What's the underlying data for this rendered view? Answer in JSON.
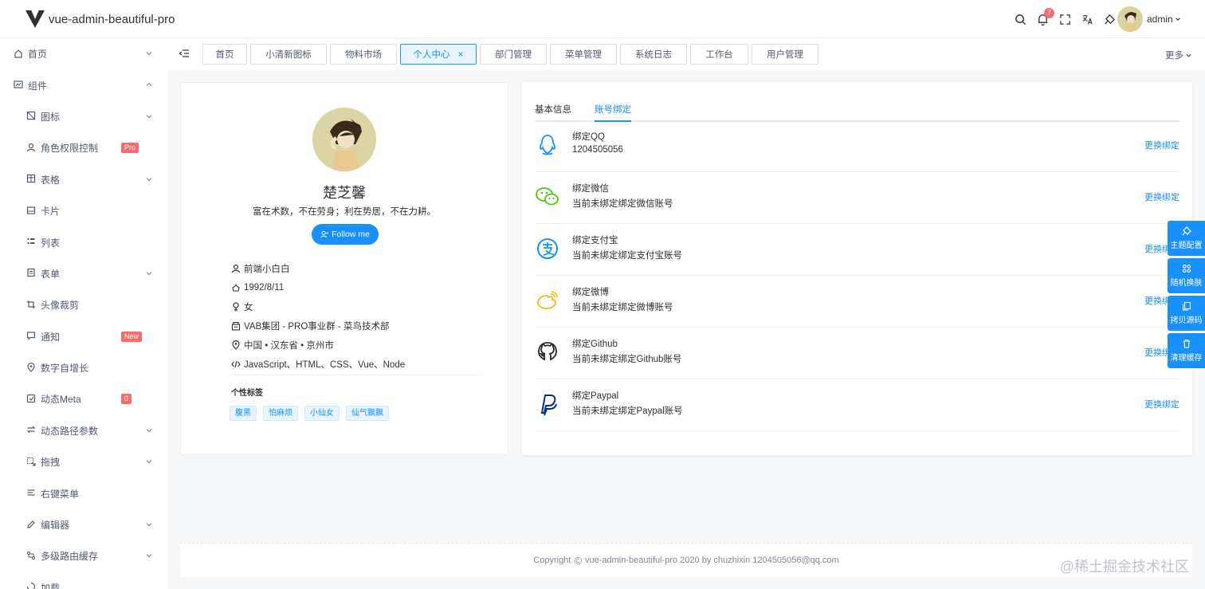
{
  "app": {
    "title": "vue-admin-beautiful-pro"
  },
  "header": {
    "notification_count": "7",
    "user_name": "admin"
  },
  "sidebar": {
    "items": [
      {
        "label": "首页",
        "icon": "home-icon",
        "level": 1,
        "arrow": "down"
      },
      {
        "label": "组件",
        "icon": "component-icon",
        "level": 1,
        "arrow": "up"
      },
      {
        "label": "图标",
        "icon": "icon-icon",
        "level": 2,
        "arrow": "down"
      },
      {
        "label": "角色权限控制",
        "icon": "user-icon",
        "level": 2,
        "badge": "Pro"
      },
      {
        "label": "表格",
        "icon": "table-icon",
        "level": 2,
        "arrow": "down"
      },
      {
        "label": "卡片",
        "icon": "card-icon",
        "level": 2
      },
      {
        "label": "列表",
        "icon": "list-icon",
        "level": 2
      },
      {
        "label": "表单",
        "icon": "form-icon",
        "level": 2,
        "arrow": "down"
      },
      {
        "label": "头像裁剪",
        "icon": "crop-icon",
        "level": 2
      },
      {
        "label": "通知",
        "icon": "message-icon",
        "level": 2,
        "badge": "New"
      },
      {
        "label": "数字自增长",
        "icon": "location-icon",
        "level": 2
      },
      {
        "label": "动态Meta",
        "icon": "meta-icon",
        "level": 2,
        "badge": "0"
      },
      {
        "label": "动态路径参数",
        "icon": "swap-icon",
        "level": 2,
        "arrow": "down"
      },
      {
        "label": "拖拽",
        "icon": "drag-icon",
        "level": 2,
        "arrow": "down"
      },
      {
        "label": "右键菜单",
        "icon": "menu-icon",
        "level": 2
      },
      {
        "label": "编辑器",
        "icon": "edit-icon",
        "level": 2,
        "arrow": "down"
      },
      {
        "label": "多级路由缓存",
        "icon": "route-icon",
        "level": 2,
        "arrow": "down"
      },
      {
        "label": "加载",
        "icon": "loading-icon",
        "level": 2
      }
    ]
  },
  "tabs": {
    "items": [
      {
        "label": "首页",
        "width": 56
      },
      {
        "label": "小清新图标",
        "width": 96
      },
      {
        "label": "物料市场",
        "width": 84
      },
      {
        "label": "个人中心",
        "width": 96,
        "active": true
      },
      {
        "label": "部门管理",
        "width": 84
      },
      {
        "label": "菜单管理",
        "width": 84
      },
      {
        "label": "系统日志",
        "width": 84
      },
      {
        "label": "工作台",
        "width": 73
      },
      {
        "label": "用户管理",
        "width": 84
      }
    ],
    "more": "更多"
  },
  "profile": {
    "name": "楚芝馨",
    "motto": "富在术数，不在劳身；利在势居，不在力耕。",
    "follow": "Follow me",
    "info": [
      {
        "icon": "user-icon",
        "text": "前端小白白"
      },
      {
        "icon": "birthday-icon",
        "text": "1992/8/11"
      },
      {
        "icon": "female-icon",
        "text": "女"
      },
      {
        "icon": "building-icon",
        "text": "VAB集团 - PRO事业群 - 菜鸟技术部"
      },
      {
        "icon": "location-icon",
        "text": "中国 • 汉东省 • 京州市"
      },
      {
        "icon": "code-icon",
        "text": "JavaScript、HTML、CSS、Vue、Node"
      }
    ],
    "tags_title": "个性标签",
    "tags": [
      "腹黑",
      "怕麻烦",
      "小仙女",
      "仙气飘飘"
    ]
  },
  "account": {
    "tabs": [
      "基本信息",
      "账号绑定"
    ],
    "active_tab": "账号绑定",
    "bindings": [
      {
        "icon": "qq-icon",
        "title": "绑定QQ",
        "desc": "1204505056",
        "action": "更换绑定",
        "color": "#1890ff"
      },
      {
        "icon": "wechat-icon",
        "title": "绑定微信",
        "desc": "当前未绑定绑定微信账号",
        "action": "更换绑定",
        "color": "#52c41a"
      },
      {
        "icon": "alipay-icon",
        "title": "绑定支付宝",
        "desc": "当前未绑定绑定支付宝账号",
        "action": "更换绑定",
        "color": "#1890ff"
      },
      {
        "icon": "weibo-icon",
        "title": "绑定微博",
        "desc": "当前未绑定绑定微博账号",
        "action": "更换绑定",
        "color": "#f5b90f"
      },
      {
        "icon": "github-icon",
        "title": "绑定Github",
        "desc": "当前未绑定绑定Github账号",
        "action": "更换绑定",
        "color": "#24292e"
      },
      {
        "icon": "paypal-icon",
        "title": "绑定Paypal",
        "desc": "当前未绑定绑定Paypal账号",
        "action": "更换绑定",
        "color": "#003087"
      }
    ]
  },
  "float_panel": [
    {
      "icon": "theme-icon",
      "label": "主题配置"
    },
    {
      "icon": "shuffle-icon",
      "label": "随机换肤"
    },
    {
      "icon": "copy-icon",
      "label": "拷贝源码"
    },
    {
      "icon": "trash-icon",
      "label": "清理缓存"
    }
  ],
  "footer": {
    "copyright_prefix": "Copyright",
    "copyright_text": "vue-admin-beautiful-pro 2020 by chuzhixin 1204505056@qq.com",
    "watermark": "@稀土掘金技术社区"
  },
  "colors": {
    "accent": "#1890ff",
    "badge": "#f56c6c"
  }
}
